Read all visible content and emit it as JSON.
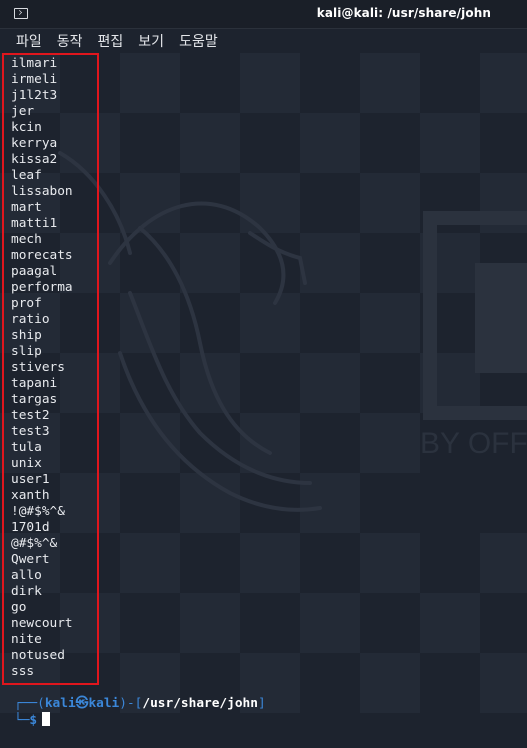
{
  "window": {
    "title": "kali@kali: /usr/share/john"
  },
  "menu": {
    "items": [
      "파일",
      "동작",
      "편집",
      "보기",
      "도움말"
    ]
  },
  "terminal": {
    "output_lines": [
      "ilmari",
      "irmeli",
      "j1l2t3",
      "jer",
      "kcin",
      "kerrya",
      "kissa2",
      "leaf",
      "lissabon",
      "mart",
      "matti1",
      "mech",
      "morecats",
      "paagal",
      "performa",
      "prof",
      "ratio",
      "ship",
      "slip",
      "stivers",
      "tapani",
      "targas",
      "test2",
      "test3",
      "tula",
      "unix",
      "user1",
      "xanth",
      "!@#$%^&",
      "1701d",
      "@#$%^&",
      "Qwert",
      "allo",
      "dirk",
      "go",
      "newcourt",
      "nite",
      "notused",
      "sss"
    ],
    "prompt": {
      "frame_top": "┌──(",
      "user": "kali㉿kali",
      "separator": ")-[",
      "path": "/usr/share/john",
      "close": "]",
      "frame_bottom": "└─",
      "symbol": "$"
    },
    "background_text": "BY OFF"
  },
  "colors": {
    "background": "#1d232e",
    "highlight_box": "#e0161d",
    "prompt_blue": "#3b87d9"
  }
}
